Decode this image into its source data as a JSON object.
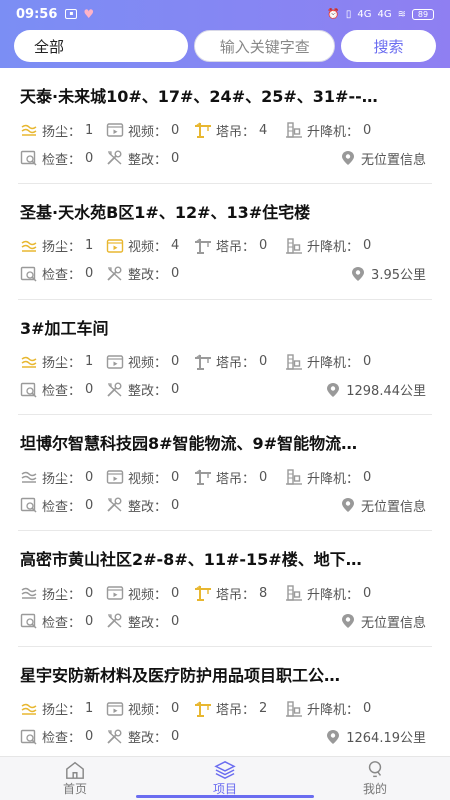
{
  "status": {
    "time": "09:56",
    "battery": "89",
    "net1": "4G",
    "net2": "4G"
  },
  "search": {
    "filter": "全部",
    "placeholder": "输入关键字查",
    "button": "搜索"
  },
  "labels": {
    "dust": "扬尘：",
    "video": "视频：",
    "crane": "塔吊：",
    "hoist": "升降机：",
    "check": "检查：",
    "fix": "整改："
  },
  "projects": [
    {
      "title": "天泰·未来城10#、17#、24#、25#、31#--…",
      "dust": "1",
      "video": "0",
      "crane": "4",
      "hoist": "0",
      "check": "0",
      "fix": "0",
      "location": "无位置信息"
    },
    {
      "title": "圣基·天水苑B区1#、12#、13#住宅楼",
      "dust": "1",
      "video": "4",
      "crane": "0",
      "hoist": "0",
      "check": "0",
      "fix": "0",
      "location": "3.95公里"
    },
    {
      "title": "3#加工车间",
      "dust": "1",
      "video": "0",
      "crane": "0",
      "hoist": "0",
      "check": "0",
      "fix": "0",
      "location": "1298.44公里"
    },
    {
      "title": "坦博尔智慧科技园8#智能物流、9#智能物流…",
      "dust": "0",
      "video": "0",
      "crane": "0",
      "hoist": "0",
      "check": "0",
      "fix": "0",
      "location": "无位置信息"
    },
    {
      "title": "高密市黄山社区2#-8#、11#-15#楼、地下…",
      "dust": "0",
      "video": "0",
      "crane": "8",
      "hoist": "0",
      "check": "0",
      "fix": "0",
      "location": "无位置信息"
    },
    {
      "title": "星宇安防新材料及医疗防护用品项目职工公…",
      "dust": "1",
      "video": "0",
      "crane": "2",
      "hoist": "0",
      "check": "0",
      "fix": "0",
      "location": "1264.19公里"
    }
  ],
  "nav": {
    "home": "首页",
    "project": "项目",
    "mine": "我的"
  },
  "colors": {
    "accent": "#6a6cf0",
    "active_icon": "#e8b730",
    "inactive_icon": "#9a9a9a"
  }
}
